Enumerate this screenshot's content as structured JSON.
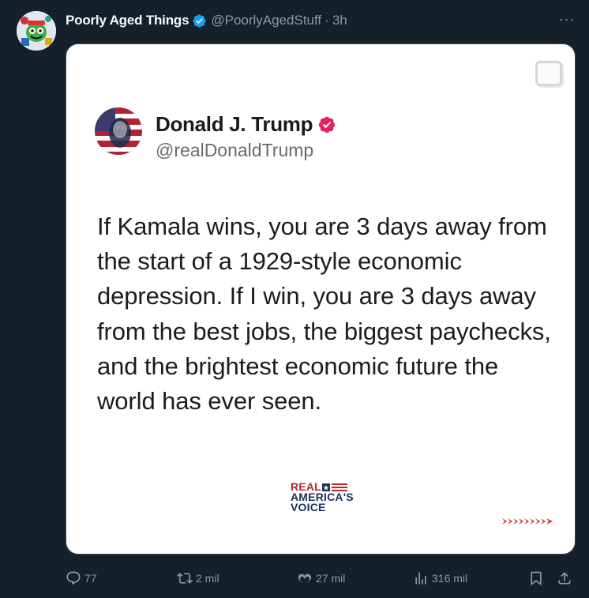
{
  "author": {
    "display_name": "Poorly Aged Things",
    "handle": "@PoorlyAgedStuff",
    "separator": "·",
    "time": "3h",
    "verified_icon": "verified-badge-icon",
    "more_label": "···"
  },
  "embedded_post": {
    "author_name": "Donald J. Trump",
    "author_handle": "@realDonaldTrump",
    "badge_color": "#e0245e",
    "text": "If Kamala wins, you are 3 days away from the start of a 1929-style economic depression. If I win, you are 3 days away from the best jobs, the biggest paychecks, and the brightest economic future the world has ever seen.",
    "watermark": {
      "line1": "REAL",
      "line2": "AMERICA'S",
      "line3": "VOICE"
    }
  },
  "actions": {
    "replies": "77",
    "reposts": "2 mil",
    "likes": "27 mil",
    "views": "316 mil"
  },
  "colors": {
    "background": "#15202b",
    "text_primary": "#f7f9f9",
    "text_secondary": "#8b98a5",
    "verified_blue": "#1d9bf0"
  }
}
